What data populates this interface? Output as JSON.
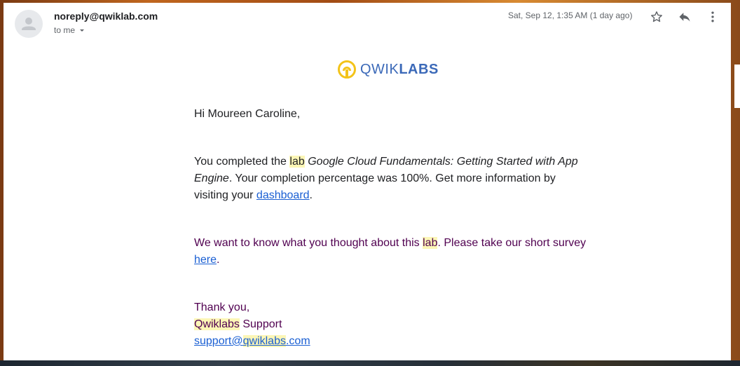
{
  "header": {
    "sender": "noreply@qwiklab.com",
    "recipient_label": "to me",
    "date": "Sat, Sep 12, 1:35 AM (1 day ago)",
    "icons": [
      "star-icon",
      "reply-icon",
      "more-vert-icon"
    ]
  },
  "logo": {
    "text_light": "QWIK",
    "text_bold": "LABS",
    "colors": {
      "yellow": "#f3c319",
      "blue": "#3b69b8"
    }
  },
  "email": {
    "greeting": "Hi Moureen Caroline,",
    "p1": {
      "pre": "You completed the ",
      "lab_word": "lab",
      "space": " ",
      "lab_title": "Google Cloud Fundamentals: Getting Started with App Engine",
      "mid": ". Your completion percentage was 100%. Get more information by visiting your ",
      "link": "dashboard",
      "post": "."
    },
    "p2": {
      "pre": "We want to know what you thought about this ",
      "lab_word": "lab",
      "mid": ". Please take our short survey ",
      "link": "here",
      "post": "."
    },
    "signoff": {
      "thanks": "Thank you,",
      "brand": "Qwiklabs",
      "support": " Support",
      "email_pre": "support@",
      "email_hl": "qwiklabs",
      "email_post": ".com"
    }
  },
  "colors": {
    "link": "#1a5fd3",
    "purple_text": "#500050",
    "highlight": "#fcf6b6"
  }
}
